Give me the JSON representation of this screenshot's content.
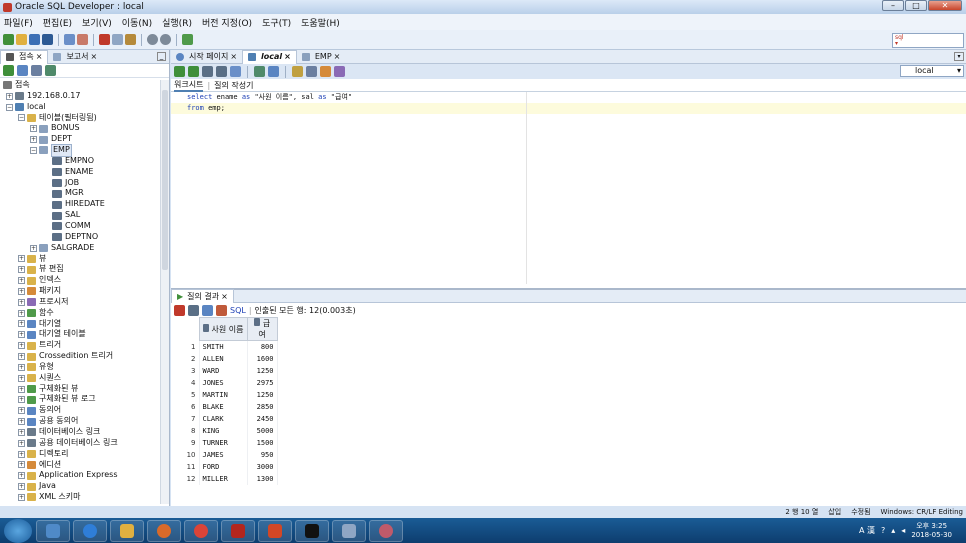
{
  "window": {
    "title": "Oracle SQL Developer : local"
  },
  "menu": [
    "파일(F)",
    "편집(E)",
    "보기(V)",
    "이동(N)",
    "실행(R)",
    "버전 지정(O)",
    "도구(T)",
    "도움말(H)"
  ],
  "left_tabs": {
    "connections": "접속",
    "reports": "보고서"
  },
  "tree": {
    "root": "접속",
    "ip": "192.168.0.17",
    "local": "local",
    "tables": "테이블(필터링됨)",
    "table_bonus": "BONUS",
    "table_dept": "DEPT",
    "table_emp": "EMP",
    "columns": [
      "EMPNO",
      "ENAME",
      "JOB",
      "MGR",
      "HIREDATE",
      "SAL",
      "COMM",
      "DEPTNO"
    ],
    "table_salgrade": "SALGRADE",
    "objects": [
      "뷰",
      "뷰 편집",
      "인덱스",
      "패키지",
      "프로시저",
      "함수",
      "대기열",
      "대기열 테이블",
      "트리거",
      "Crossedition 트리거",
      "유형",
      "시퀀스",
      "구체화된 뷰",
      "구체화된 뷰 로그",
      "동의어",
      "공용 동의어",
      "데이터베이스 링크",
      "공용 데이터베이스 링크",
      "디렉토리",
      "에디션",
      "Application Express",
      "Java",
      "XML 스키마"
    ]
  },
  "editor_tabs": {
    "start": "시작 페이지",
    "local": "local",
    "emp": "EMP"
  },
  "connection_select": "local",
  "subtabs": {
    "worksheet": "워크시트",
    "query_builder": "질의 작성기"
  },
  "sql": {
    "l1_kw1": "select",
    "l1_a": " ename ",
    "l1_kw2": "as",
    "l1_b": " \"사원 이름\", sal ",
    "l1_kw3": "as",
    "l1_c": " \"급여\"",
    "l2_kw1": "from",
    "l2_a": " emp;"
  },
  "results": {
    "tab": "질의 결과",
    "sql_label": "SQL",
    "fetched": "인출된 모든 행: 12(0.003초)",
    "col_name": "사원 이름",
    "col_sal": "급여",
    "rows": [
      {
        "n": "1",
        "name": "SMITH",
        "sal": "800"
      },
      {
        "n": "2",
        "name": "ALLEN",
        "sal": "1600"
      },
      {
        "n": "3",
        "name": "WARD",
        "sal": "1250"
      },
      {
        "n": "4",
        "name": "JONES",
        "sal": "2975"
      },
      {
        "n": "5",
        "name": "MARTIN",
        "sal": "1250"
      },
      {
        "n": "6",
        "name": "BLAKE",
        "sal": "2850"
      },
      {
        "n": "7",
        "name": "CLARK",
        "sal": "2450"
      },
      {
        "n": "8",
        "name": "KING",
        "sal": "5000"
      },
      {
        "n": "9",
        "name": "TURNER",
        "sal": "1500"
      },
      {
        "n": "10",
        "name": "JAMES",
        "sal": "950"
      },
      {
        "n": "11",
        "name": "FORD",
        "sal": "3000"
      },
      {
        "n": "12",
        "name": "MILLER",
        "sal": "1300"
      }
    ]
  },
  "status": {
    "position": "2 행 10 열",
    "insert": "삽입",
    "modified": "수정됨",
    "eol": "Windows: CR/LF Editing"
  },
  "clock": {
    "time": "오후 3:25",
    "date": "2018-05-30"
  },
  "tray_ime": "A 漢"
}
